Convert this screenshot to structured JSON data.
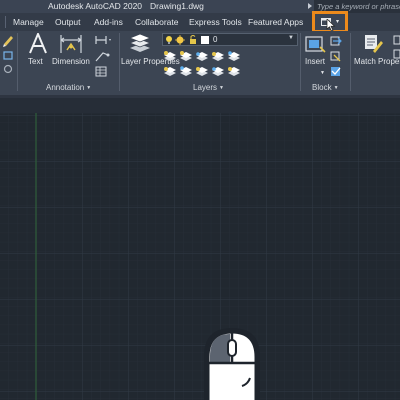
{
  "app": {
    "title": "Autodesk AutoCAD 2020",
    "filename": "Drawing1.dwg",
    "search_placeholder": "Type a keyword or phrase"
  },
  "tabs": [
    "Manage",
    "Output",
    "Add-ins",
    "Collaborate",
    "Express Tools",
    "Featured Apps"
  ],
  "ribbon": {
    "annotation": {
      "title": "Annotation",
      "text_label": "Text",
      "dimension_label": "Dimension"
    },
    "layers": {
      "title": "Layers",
      "layer_properties_label": "Layer Properties",
      "current_layer": "0"
    },
    "block": {
      "title": "Block",
      "insert_label": "Insert"
    },
    "properties": {
      "match_properties_label": "Match Properties"
    }
  },
  "colors": {
    "highlight": "#ec8a1c",
    "canvas": "#212830",
    "ribbon": "#3c4553"
  },
  "icons": [
    "workspace-switch-icon",
    "pointer-cursor-icon",
    "mouse-icon",
    "text-icon",
    "dimension-icon",
    "layer-properties-icon",
    "insert-block-icon",
    "match-properties-icon"
  ]
}
